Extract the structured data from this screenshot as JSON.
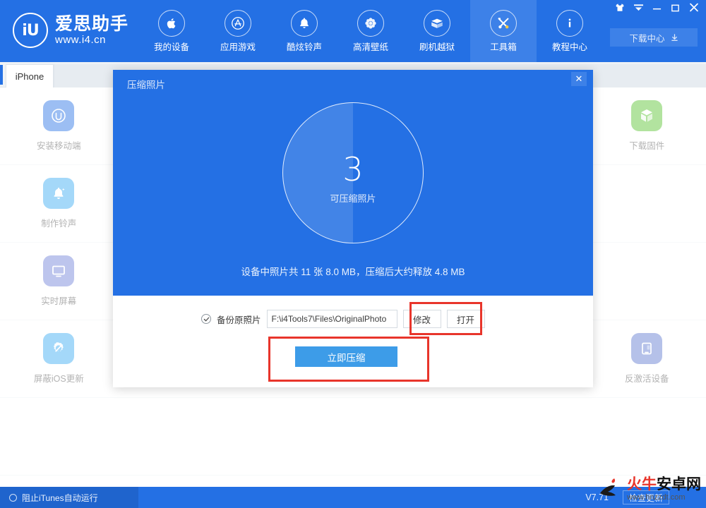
{
  "brand": {
    "mark": "iU",
    "title": "爱思助手",
    "url": "www.i4.cn"
  },
  "header": {
    "nav": [
      {
        "label": "我的设备",
        "icon": "apple-icon",
        "active": false
      },
      {
        "label": "应用游戏",
        "icon": "appstore-icon",
        "active": false
      },
      {
        "label": "酷炫铃声",
        "icon": "bell-icon",
        "active": false
      },
      {
        "label": "高清壁纸",
        "icon": "flower-icon",
        "active": false
      },
      {
        "label": "刷机越狱",
        "icon": "box-icon",
        "active": false
      },
      {
        "label": "工具箱",
        "icon": "tools-icon",
        "active": true
      },
      {
        "label": "教程中心",
        "icon": "info-icon",
        "active": false
      }
    ],
    "download_center": "下载中心",
    "window_controls": [
      "skin-icon",
      "menu-icon",
      "minimize-icon",
      "maximize-icon",
      "close-icon"
    ]
  },
  "tabs": {
    "active": "iPhone"
  },
  "toolbox": {
    "rows": [
      [
        {
          "label": "安装移动端",
          "icon": "iu-app-icon",
          "color": "#2470e4"
        },
        {
          "label": "",
          "icon": "",
          "color": ""
        },
        {
          "label": "",
          "icon": "",
          "color": ""
        },
        {
          "label": "",
          "icon": "",
          "color": ""
        },
        {
          "label": "",
          "icon": "",
          "color": ""
        },
        {
          "label": "下载固件",
          "icon": "cube-icon",
          "color": "#54c02c"
        }
      ],
      [
        {
          "label": "制作铃声",
          "icon": "bell-app-icon",
          "color": "#35a9f2"
        },
        {
          "label": "",
          "icon": "",
          "color": ""
        },
        {
          "label": "",
          "icon": "",
          "color": ""
        },
        {
          "label": "",
          "icon": "",
          "color": ""
        },
        {
          "label": "",
          "icon": "",
          "color": ""
        },
        {
          "label": "",
          "icon": "",
          "color": ""
        }
      ],
      [
        {
          "label": "实时屏幕",
          "icon": "monitor-icon",
          "color": "#6e7fd8"
        },
        {
          "label": "",
          "icon": "",
          "color": ""
        },
        {
          "label": "",
          "icon": "",
          "color": ""
        },
        {
          "label": "",
          "icon": "",
          "color": ""
        },
        {
          "label": "",
          "icon": "",
          "color": ""
        },
        {
          "label": "",
          "icon": "",
          "color": ""
        }
      ],
      [
        {
          "label": "屏蔽iOS更新",
          "icon": "gear-block-icon",
          "color": "#35a9f2"
        },
        {
          "label": "",
          "icon": "",
          "color": ""
        },
        {
          "label": "",
          "icon": "",
          "color": ""
        },
        {
          "label": "",
          "icon": "",
          "color": ""
        },
        {
          "label": "",
          "icon": "",
          "color": ""
        },
        {
          "label": "反激活设备",
          "icon": "device-icon",
          "color": "#5b77cf"
        }
      ],
      [
        {
          "label": "",
          "icon": "",
          "color": ""
        },
        {
          "label": "",
          "icon": "",
          "color": ""
        },
        {
          "label": "",
          "icon": "",
          "color": ""
        },
        {
          "label": "",
          "icon": "",
          "color": ""
        },
        {
          "label": "",
          "icon": "",
          "color": ""
        },
        {
          "label": "",
          "icon": "",
          "color": ""
        }
      ]
    ]
  },
  "modal": {
    "title": "压缩照片",
    "close": "✕",
    "dial": {
      "count": "3",
      "caption": "可压缩照片"
    },
    "summary": "设备中照片共 11 张 8.0 MB，压缩后大约释放 4.8 MB",
    "backup_label": "备份原照片",
    "backup_path": "F:\\i4Tools7\\Files\\OriginalPhoto",
    "btn_modify": "修改",
    "btn_open": "打开",
    "btn_compress": "立即压缩",
    "highlight_color": "#e8352b"
  },
  "statusbar": {
    "block_itunes": "阻止iTunes自动运行",
    "version": "V7.71",
    "check_update": "检查更新"
  },
  "watermark": {
    "main_red": "火牛",
    "main_black": "安卓网",
    "url": "www.hnzzdt.com"
  }
}
